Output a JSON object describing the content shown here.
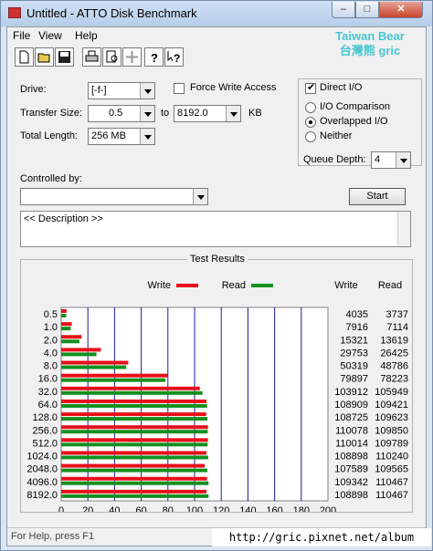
{
  "window": {
    "title": "Untitled - ATTO Disk Benchmark",
    "min": "–",
    "max": "□",
    "close": "✕"
  },
  "menu": [
    "File",
    "View",
    "Help"
  ],
  "watermark": {
    "line1": "Taiwan Bear",
    "line2": "台灣熊 gric"
  },
  "toolbar": [
    "new-icon",
    "open-icon",
    "save-icon",
    "print-icon",
    "print-preview-icon",
    "move-icon",
    "help-icon",
    "context-help-icon"
  ],
  "form": {
    "drive_label": "Drive:",
    "drive_value": "[-f-]",
    "force_write_label": "Force Write Access",
    "force_write_checked": false,
    "direct_io_label": "Direct I/O",
    "direct_io_checked": true,
    "transfer_size_label": "Transfer Size:",
    "transfer_from": "0.5",
    "to_label": "to",
    "transfer_to": "8192.0",
    "kb_label": "KB",
    "total_length_label": "Total Length:",
    "total_length": "256 MB",
    "io_comparison_label": "I/O Comparison",
    "overlapped_io_label": "Overlapped I/O",
    "neither_label": "Neither",
    "io_mode_selected": "Overlapped I/O",
    "queue_depth_label": "Queue Depth:",
    "queue_depth": "4",
    "controlled_by_label": "Controlled by:",
    "controlled_by_value": "",
    "start_label": "Start",
    "description_text": "<< Description >>"
  },
  "results": {
    "title": "Test Results",
    "write_label": "Write",
    "read_label": "Read",
    "write_col": "Write",
    "read_col": "Read",
    "xlabel": "Transfer Rate - MB / Sec"
  },
  "colors": {
    "write": "#e8101a",
    "read": "#14901e",
    "grid": "#1a1aa8"
  },
  "chart_data": {
    "type": "bar",
    "orientation": "horizontal",
    "categories": [
      "0.5",
      "1.0",
      "2.0",
      "4.0",
      "8.0",
      "16.0",
      "32.0",
      "64.0",
      "128.0",
      "256.0",
      "512.0",
      "1024.0",
      "2048.0",
      "4096.0",
      "8192.0"
    ],
    "series": [
      {
        "name": "Write",
        "values": [
          4035,
          7916,
          15321,
          29753,
          50319,
          79897,
          103912,
          108909,
          108725,
          110078,
          110014,
          108898,
          107589,
          109342,
          108898
        ]
      },
      {
        "name": "Read",
        "values": [
          3737,
          7114,
          13619,
          26425,
          48786,
          78223,
          105949,
          109421,
          109623,
          109850,
          109789,
          110240,
          109565,
          110467,
          110467
        ]
      }
    ],
    "xlabel": "Transfer Rate - MB / Sec",
    "xticks": [
      "0",
      "20",
      "40",
      "60",
      "80",
      "100",
      "120",
      "140",
      "160",
      "180",
      "200"
    ],
    "xlim": [
      0,
      200
    ],
    "value_unit_on_axis": "MB/s",
    "grid": true,
    "legend": "top"
  },
  "status": {
    "text": "For Help, press F1"
  },
  "overlay": {
    "url": "http://gric.pixnet.net/album"
  }
}
